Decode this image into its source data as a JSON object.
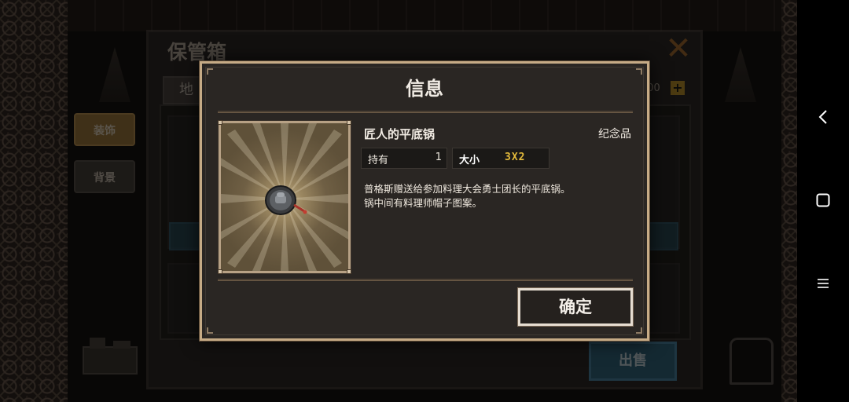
{
  "background": {
    "storage_title": "保管箱",
    "tab_label": "地",
    "count_text": "300",
    "plus_label": "+",
    "categories": [
      "装饰",
      "背景"
    ],
    "sell_button": "出售"
  },
  "dialog": {
    "title": "信息",
    "item_name": "匠人的平底锅",
    "item_category": "纪念品",
    "own_label": "持有",
    "own_value": "1",
    "size_label": "大小",
    "size_value": "3X2",
    "description_line1": "普格斯赠送给参加料理大会勇士团长的平底锅。",
    "description_line2": "锅中间有料理师帽子图案。",
    "confirm_button": "确定"
  },
  "icons": {
    "back": "back-icon",
    "home": "home-icon",
    "menu": "menu-icon",
    "item": "frying-pan-icon",
    "close": "close-icon"
  },
  "colors": {
    "dialog_border": "#c6ab86",
    "size_value": "#e2b93b",
    "sell_button": "#2f6a87",
    "active_category": "#a87f3c"
  }
}
